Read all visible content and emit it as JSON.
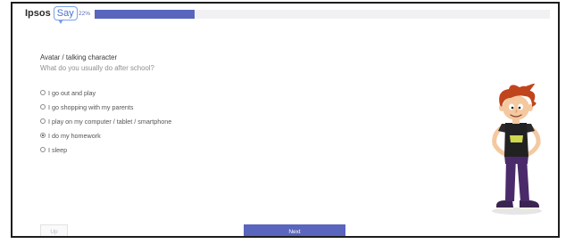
{
  "header": {
    "logo_brand": "Ipsos",
    "logo_product": "Say",
    "progress_label": "22%",
    "progress_value": 0.22
  },
  "question": {
    "title": "Avatar / talking character",
    "text": "What do you usually do after school?",
    "options": [
      {
        "label": "I go out and play",
        "selected": false
      },
      {
        "label": "I go shopping with my parents",
        "selected": false
      },
      {
        "label": "I play on my computer / tablet / smartphone",
        "selected": false
      },
      {
        "label": "I do my homework",
        "selected": true
      },
      {
        "label": "I sleep",
        "selected": false
      }
    ]
  },
  "footer": {
    "up_label": "Up",
    "next_label": "Next"
  },
  "colors": {
    "accent": "#5a65bd",
    "logo_blue": "#4a6fd0",
    "avatar_hair": "#c0451c",
    "avatar_shirt": "#222222",
    "avatar_pants": "#4b2a6b"
  },
  "icons": {
    "avatar": "cartoon-boy-avatar"
  }
}
